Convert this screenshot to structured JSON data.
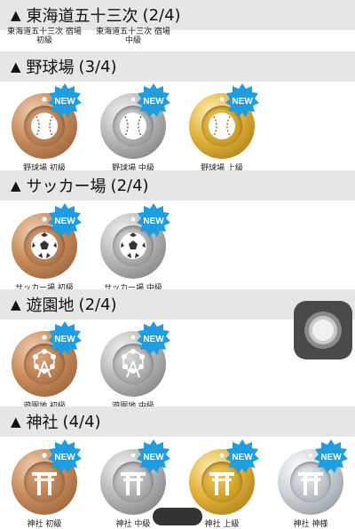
{
  "colors": {
    "header_bg": "#e6e6e6",
    "new_badge": "#1e9ee0"
  },
  "sections": [
    {
      "title": "東海道五十三次",
      "count": "(2/4)",
      "medals": [
        {
          "label": "東海道五十三次 宿場\n初級"
        },
        {
          "label": "東海道五十三次 宿場\n中級"
        }
      ]
    },
    {
      "title": "野球場",
      "count": "(3/4)",
      "medals": [
        {
          "label": "野球場 初級",
          "tier": "bronze",
          "icon": "baseball-icon",
          "badge": "NEW"
        },
        {
          "label": "野球場 中級",
          "tier": "silver",
          "icon": "baseball-icon",
          "badge": "NEW"
        },
        {
          "label": "野球場 上級",
          "tier": "gold",
          "icon": "baseball-icon",
          "badge": "NEW"
        }
      ]
    },
    {
      "title": "サッカー場",
      "count": "(2/4)",
      "medals": [
        {
          "label": "サッカー場 初級",
          "tier": "bronze",
          "icon": "soccer-ball-icon",
          "badge": "NEW"
        },
        {
          "label": "サッカー場 中級",
          "tier": "silver",
          "icon": "soccer-ball-icon",
          "badge": "NEW"
        }
      ]
    },
    {
      "title": "遊園地",
      "count": "(2/4)",
      "medals": [
        {
          "label": "遊園地 初級",
          "tier": "bronze",
          "icon": "ferris-wheel-icon",
          "badge": "NEW"
        },
        {
          "label": "遊園地 中級",
          "tier": "silver",
          "icon": "ferris-wheel-icon",
          "badge": "NEW"
        }
      ]
    },
    {
      "title": "神社",
      "count": "(4/4)",
      "medals": [
        {
          "label": "神社 初級",
          "tier": "bronze",
          "icon": "torii-icon",
          "badge": "NEW"
        },
        {
          "label": "神社 中級",
          "tier": "silver",
          "icon": "torii-icon",
          "badge": "NEW"
        },
        {
          "label": "神社 上級",
          "tier": "gold",
          "icon": "torii-icon",
          "badge": "NEW"
        },
        {
          "label": "神社 神様",
          "tier": "platinum",
          "icon": "torii-icon",
          "badge": "NEW"
        }
      ]
    }
  ]
}
